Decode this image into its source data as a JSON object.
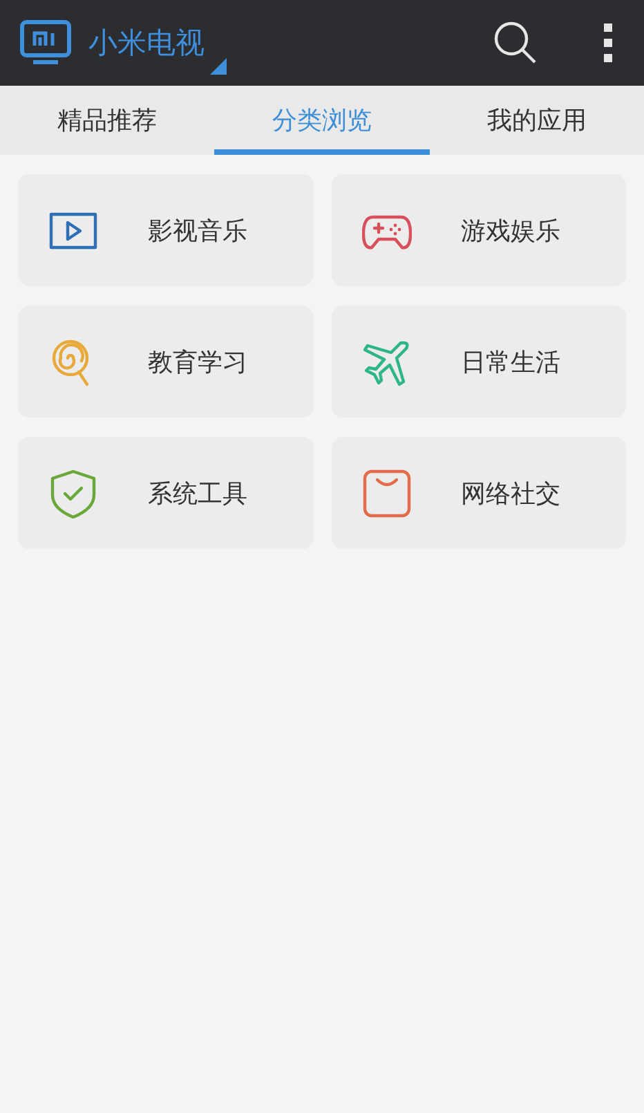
{
  "header": {
    "title": "小米电视"
  },
  "tabs": [
    {
      "label": "精品推荐",
      "selected": false
    },
    {
      "label": "分类浏览",
      "selected": true
    },
    {
      "label": "我的应用",
      "selected": false
    }
  ],
  "categories": [
    {
      "label": "影视音乐",
      "kind": "video",
      "color": "#2f6fb5"
    },
    {
      "label": "游戏娱乐",
      "kind": "game",
      "color": "#d8505c"
    },
    {
      "label": "教育学习",
      "kind": "lollipop",
      "color": "#e8a93a"
    },
    {
      "label": "日常生活",
      "kind": "plane",
      "color": "#2fb58a"
    },
    {
      "label": "系统工具",
      "kind": "shield",
      "color": "#6aa83a"
    },
    {
      "label": "网络社交",
      "kind": "bag",
      "color": "#e36a4a"
    }
  ]
}
